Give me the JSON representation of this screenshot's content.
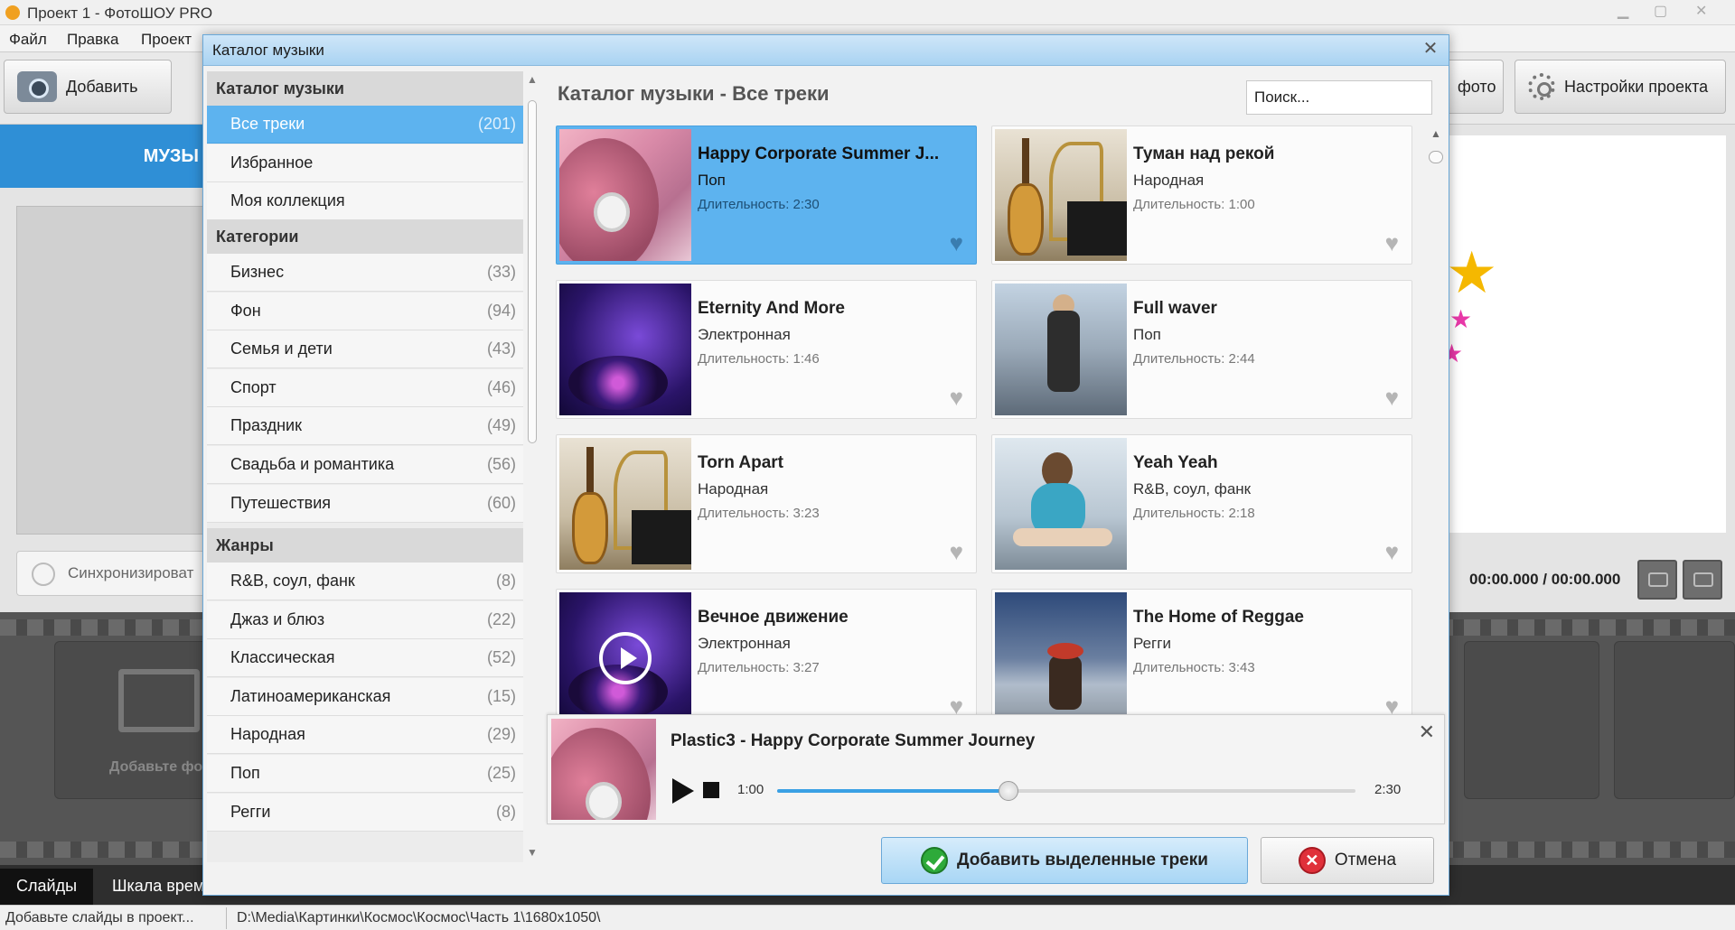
{
  "app": {
    "title": "Проект 1 - ФотоШОУ PRO",
    "menu": [
      "Файл",
      "Правка",
      "Проект"
    ],
    "toolbar": {
      "add_label": "Добавить",
      "photo_label": "фото",
      "settings_label": "Настройки проекта"
    },
    "left_panel": {
      "music_tab": "МУЗЫ",
      "sync_label": "Синхронизироват"
    },
    "slide_placeholder": "Добавьте фо",
    "time_readout": "00:00.000 / 00:00.000",
    "bottom_tabs": [
      "Слайды",
      "Шкала врем"
    ],
    "status": {
      "left": "Добавьте слайды в проект...",
      "path": "D:\\Media\\Картинки\\Космос\\Космос\\Часть 1\\1680x1050\\"
    }
  },
  "dialog": {
    "title": "Каталог музыки",
    "close_glyph": "✕",
    "sidebar": {
      "catalog_header": "Каталог музыки",
      "catalog_items": [
        {
          "label": "Все треки",
          "count": "(201)",
          "active": true
        },
        {
          "label": "Избранное",
          "count": ""
        },
        {
          "label": "Моя коллекция",
          "count": ""
        }
      ],
      "categories_header": "Категории",
      "categories": [
        {
          "label": "Бизнес",
          "count": "(33)"
        },
        {
          "label": "Фон",
          "count": "(94)"
        },
        {
          "label": "Семья и дети",
          "count": "(43)"
        },
        {
          "label": "Спорт",
          "count": "(46)"
        },
        {
          "label": "Праздник",
          "count": "(49)"
        },
        {
          "label": "Свадьба и романтика",
          "count": "(56)"
        },
        {
          "label": "Путешествия",
          "count": "(60)"
        }
      ],
      "genres_header": "Жанры",
      "genres": [
        {
          "label": "R&B, соул, фанк",
          "count": "(8)"
        },
        {
          "label": "Джаз и блюз",
          "count": "(22)"
        },
        {
          "label": "Классическая",
          "count": "(52)"
        },
        {
          "label": "Латиноамериканская",
          "count": "(15)"
        },
        {
          "label": "Народная",
          "count": "(29)"
        },
        {
          "label": "Поп",
          "count": "(25)"
        },
        {
          "label": "Регги",
          "count": "(8)"
        }
      ]
    },
    "content_title": "Каталог музыки - Все треки",
    "search": {
      "placeholder": "Поиск..."
    },
    "tracks": [
      {
        "title": "Happy Corporate Summer J...",
        "genre": "Поп",
        "duration": "Длительность: 2:30",
        "thumb": "girl",
        "selected": true
      },
      {
        "title": "Туман над рекой",
        "genre": "Народная",
        "duration": "Длительность: 1:00",
        "thumb": "guitar"
      },
      {
        "title": "Eternity And More",
        "genre": "Электронная",
        "duration": "Длительность: 1:46",
        "thumb": "dj"
      },
      {
        "title": "Full waver",
        "genre": "Поп",
        "duration": "Длительность: 2:44",
        "thumb": "street"
      },
      {
        "title": "Torn Apart",
        "genre": "Народная",
        "duration": "Длительность: 3:23",
        "thumb": "guitar"
      },
      {
        "title": "Yeah Yeah",
        "genre": "R&B, соул, фанк",
        "duration": "Длительность: 2:18",
        "thumb": "skate"
      },
      {
        "title": "Вечное движение",
        "genre": "Электронная",
        "duration": "Длительность: 3:27",
        "thumb": "dj",
        "playing": true
      },
      {
        "title": "The Home of Reggae",
        "genre": "Регги",
        "duration": "Длительность: 3:43",
        "thumb": "reggae"
      }
    ],
    "player": {
      "title": "Plastic3 - Happy Corporate Summer Journey",
      "current_time": "1:00",
      "total_time": "2:30",
      "progress": 0.4,
      "close_glyph": "✕"
    },
    "add_button": "Добавить выделенные треки",
    "cancel_button": "Отмена"
  }
}
